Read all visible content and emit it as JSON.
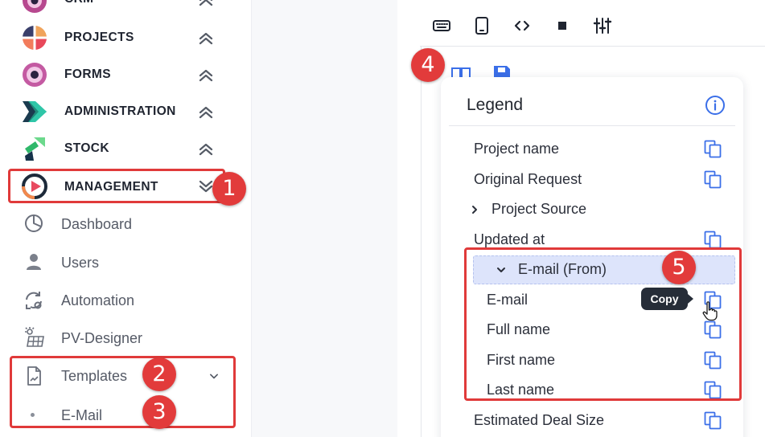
{
  "sidebar": {
    "apps": [
      {
        "label": "CRM"
      },
      {
        "label": "PROJECTS"
      },
      {
        "label": "FORMS"
      },
      {
        "label": "ADMINISTRATION"
      },
      {
        "label": "STOCK"
      },
      {
        "label": "MANAGEMENT"
      }
    ],
    "sub_items": [
      {
        "label": "Dashboard",
        "icon": "pie-chart-icon"
      },
      {
        "label": "Users",
        "icon": "user-icon"
      },
      {
        "label": "Automation",
        "icon": "automation-icon"
      },
      {
        "label": "PV-Designer",
        "icon": "solar-panel-icon"
      },
      {
        "label": "Templates",
        "icon": "document-icon"
      },
      {
        "label": "E-Mail",
        "icon": "bullet-icon"
      }
    ]
  },
  "toolbar": {
    "icons": [
      "keyboard-icon",
      "mobile-icon",
      "code-icon",
      "square-icon",
      "sliders-icon"
    ]
  },
  "legend": {
    "title": "Legend",
    "fields": [
      {
        "label": "Project name"
      },
      {
        "label": "Original Request"
      },
      {
        "label": "Project Source"
      },
      {
        "label": "Updated at"
      },
      {
        "label": "E-mail (From)"
      },
      {
        "label": "E-mail"
      },
      {
        "label": "Full name"
      },
      {
        "label": "First name"
      },
      {
        "label": "Last name"
      },
      {
        "label": "Estimated Deal Size"
      }
    ]
  },
  "tooltip": {
    "text": "Copy"
  },
  "annotations": {
    "badges": [
      "1",
      "2",
      "3",
      "4",
      "5"
    ]
  },
  "colors": {
    "accent": "#3b6fe8",
    "annotation_red": "#e03a3a",
    "group_highlight": "#dde4fb",
    "tooltip_bg": "#262d38"
  }
}
